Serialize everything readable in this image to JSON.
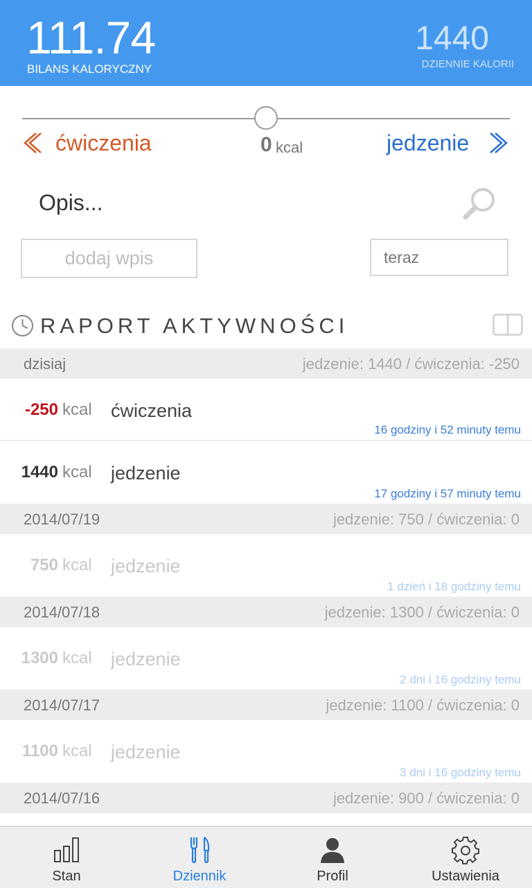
{
  "header": {
    "balance_value": "111.74",
    "balance_label": "BILANS KALORYCZNY",
    "daily_value": "1440",
    "daily_label": "DZIENNIE KALORII"
  },
  "entry_form": {
    "exercise_label": "ćwiczenia",
    "food_label": "jedzenie",
    "kcal_value": "0",
    "kcal_unit": "kcal",
    "slider_position_fraction": 0.5,
    "description_placeholder": "Opis...",
    "add_button_label": "dodaj wpis",
    "time_value": "teraz"
  },
  "report": {
    "title": "RAPORT AKTYWNOŚCI",
    "days": [
      {
        "date": "dzisiaj",
        "summary": "jedzenie: 1440 / ćwiczenia: -250",
        "entries": [
          {
            "value": "-250",
            "unit": "kcal",
            "label": "ćwiczenia",
            "time": "16 godziny i 52 minuty temu",
            "style": "e-active e-neg"
          },
          {
            "value": "1440",
            "unit": "kcal",
            "label": "jedzenie",
            "time": "17 godziny i 57 minuty temu",
            "style": "e-active"
          }
        ]
      },
      {
        "date": "2014/07/19",
        "summary": "jedzenie: 750 / ćwiczenia: 0",
        "entries": [
          {
            "value": "750",
            "unit": "kcal",
            "label": "jedzenie",
            "time": "1 dzień i 18 godziny temu",
            "style": "e-faded"
          }
        ]
      },
      {
        "date": "2014/07/18",
        "summary": "jedzenie: 1300 / ćwiczenia: 0",
        "entries": [
          {
            "value": "1300",
            "unit": "kcal",
            "label": "jedzenie",
            "time": "2 dni i 16 godziny temu",
            "style": "e-faded"
          }
        ]
      },
      {
        "date": "2014/07/17",
        "summary": "jedzenie: 1100 / ćwiczenia: 0",
        "entries": [
          {
            "value": "1100",
            "unit": "kcal",
            "label": "jedzenie",
            "time": "3 dni i 16 godziny temu",
            "style": "e-faded"
          }
        ]
      },
      {
        "date": "2014/07/16",
        "summary": "jedzenie: 900 / ćwiczenia: 0",
        "entries": []
      }
    ]
  },
  "bottom_nav": {
    "items": [
      {
        "label": "Stan",
        "icon": "bar-chart-icon",
        "active": false
      },
      {
        "label": "Dziennik",
        "icon": "fork-knife-icon",
        "active": true
      },
      {
        "label": "Profil",
        "icon": "user-icon",
        "active": false
      },
      {
        "label": "Ustawienia",
        "icon": "gear-icon",
        "active": false
      }
    ]
  },
  "colors": {
    "header_bg": "#4499ee",
    "exercise": "#d35a28",
    "food": "#2a6fd0",
    "negative": "#c0131c",
    "nav_active": "#2a7fe0"
  }
}
